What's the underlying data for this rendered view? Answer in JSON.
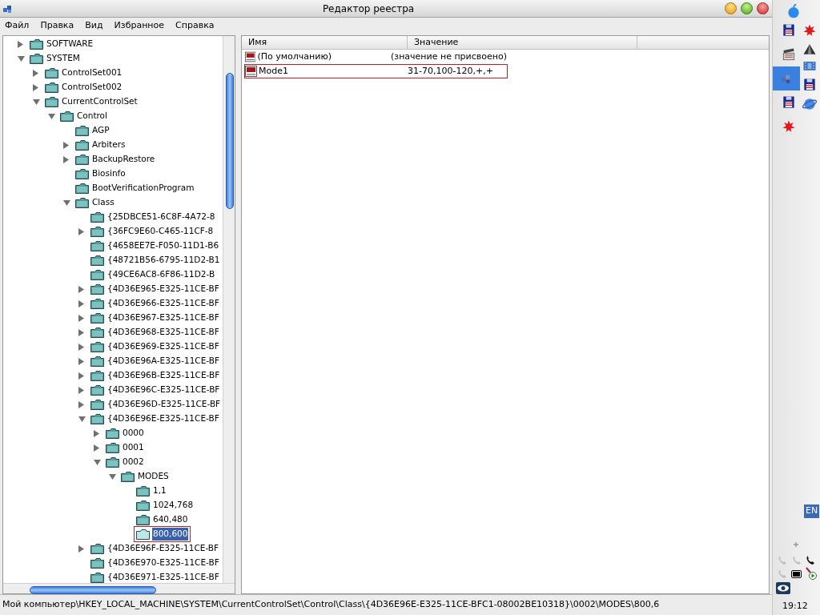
{
  "window": {
    "title": "Редактор реестра"
  },
  "menu": [
    "Файл",
    "Правка",
    "Вид",
    "Избранное",
    "Справка"
  ],
  "tree": [
    {
      "label": "SOFTWARE",
      "expanded": false,
      "selected": false,
      "marked": false
    },
    {
      "label": "SYSTEM",
      "expanded": true,
      "selected": false,
      "marked": false,
      "children": [
        {
          "label": "ControlSet001",
          "expanded": false,
          "selected": false,
          "marked": false
        },
        {
          "label": "ControlSet002",
          "expanded": false,
          "selected": false,
          "marked": false
        },
        {
          "label": "CurrentControlSet",
          "expanded": true,
          "selected": false,
          "marked": false,
          "children": [
            {
              "label": "Control",
              "expanded": true,
              "selected": false,
              "marked": false,
              "children": [
                {
                  "label": "AGP",
                  "selected": false,
                  "marked": false
                },
                {
                  "label": "Arbiters",
                  "expanded": false,
                  "selected": false,
                  "marked": false
                },
                {
                  "label": "BackupRestore",
                  "expanded": false,
                  "selected": false,
                  "marked": false
                },
                {
                  "label": "Biosinfo",
                  "selected": false,
                  "marked": false
                },
                {
                  "label": "BootVerificationProgram",
                  "selected": false,
                  "marked": false
                },
                {
                  "label": "Class",
                  "expanded": true,
                  "selected": false,
                  "marked": false,
                  "children": [
                    {
                      "label": "{25DBCE51-6C8F-4A72-8",
                      "selected": false,
                      "marked": false
                    },
                    {
                      "label": "{36FC9E60-C465-11CF-8",
                      "expanded": false,
                      "selected": false,
                      "marked": false
                    },
                    {
                      "label": "{4658EE7E-F050-11D1-B6",
                      "selected": false,
                      "marked": false
                    },
                    {
                      "label": "{48721B56-6795-11D2-B1",
                      "selected": false,
                      "marked": false
                    },
                    {
                      "label": "{49CE6AC8-6F86-11D2-B",
                      "selected": false,
                      "marked": false
                    },
                    {
                      "label": "{4D36E965-E325-11CE-BF",
                      "expanded": false,
                      "selected": false,
                      "marked": false
                    },
                    {
                      "label": "{4D36E966-E325-11CE-BF",
                      "expanded": false,
                      "selected": false,
                      "marked": false
                    },
                    {
                      "label": "{4D36E967-E325-11CE-BF",
                      "expanded": false,
                      "selected": false,
                      "marked": false
                    },
                    {
                      "label": "{4D36E968-E325-11CE-BF",
                      "expanded": false,
                      "selected": false,
                      "marked": false
                    },
                    {
                      "label": "{4D36E969-E325-11CE-BF",
                      "expanded": false,
                      "selected": false,
                      "marked": false
                    },
                    {
                      "label": "{4D36E96A-E325-11CE-BF",
                      "expanded": false,
                      "selected": false,
                      "marked": false
                    },
                    {
                      "label": "{4D36E96B-E325-11CE-BF",
                      "expanded": false,
                      "selected": false,
                      "marked": false
                    },
                    {
                      "label": "{4D36E96C-E325-11CE-BF",
                      "expanded": false,
                      "selected": false,
                      "marked": false
                    },
                    {
                      "label": "{4D36E96D-E325-11CE-BF",
                      "expanded": false,
                      "selected": false,
                      "marked": false
                    },
                    {
                      "label": "{4D36E96E-E325-11CE-BF",
                      "expanded": true,
                      "selected": false,
                      "marked": false,
                      "children": [
                        {
                          "label": "0000",
                          "expanded": false,
                          "selected": false,
                          "marked": false
                        },
                        {
                          "label": "0001",
                          "expanded": false,
                          "selected": false,
                          "marked": false
                        },
                        {
                          "label": "0002",
                          "expanded": true,
                          "selected": false,
                          "marked": false,
                          "children": [
                            {
                              "label": "MODES",
                              "expanded": true,
                              "selected": false,
                              "marked": false,
                              "children": [
                                {
                                  "label": "1,1",
                                  "selected": false,
                                  "marked": false
                                },
                                {
                                  "label": "1024,768",
                                  "selected": false,
                                  "marked": false
                                },
                                {
                                  "label": "640,480",
                                  "selected": false,
                                  "marked": false
                                },
                                {
                                  "label": "800,600",
                                  "selected": true,
                                  "marked": true
                                }
                              ]
                            }
                          ]
                        }
                      ]
                    },
                    {
                      "label": "{4D36E96F-E325-11CE-BF",
                      "expanded": false,
                      "selected": false,
                      "marked": false
                    },
                    {
                      "label": "{4D36E970-E325-11CE-BF",
                      "selected": false,
                      "marked": false
                    },
                    {
                      "label": "{4D36E971-E325-11CE-BF",
                      "selected": false,
                      "marked": false
                    }
                  ]
                }
              ]
            }
          ]
        }
      ]
    }
  ],
  "values": {
    "columns": [
      "Имя",
      "Значение"
    ],
    "rows": [
      {
        "name": "(По умолчанию)",
        "value": "(значение не присвоено)",
        "marked": false
      },
      {
        "name": "Mode1",
        "value": "31-70,100-120,+,+",
        "marked": true
      }
    ]
  },
  "status_bar": "Мой компьютер\\HKEY_LOCAL_MACHINE\\SYSTEM\\CurrentControlSet\\Control\\Class\\{4D36E96E-E325-11CE-BFC1-08002BE10318}\\0002\\MODES\\800,6",
  "dock": {
    "items": [
      {
        "kind": "apple",
        "selected": false
      },
      {
        "kind": "floppy",
        "selected": false
      },
      {
        "kind": "splat",
        "selected": false
      },
      {
        "kind": "clapper",
        "selected": false
      },
      {
        "kind": "pyramid",
        "selected": false
      },
      {
        "kind": "cubes",
        "selected": true
      },
      {
        "kind": "film",
        "selected": false
      },
      {
        "kind": "floppy",
        "selected": false
      },
      {
        "kind": "floppy",
        "selected": false
      },
      {
        "kind": "globe",
        "selected": false
      },
      {
        "kind": "splat",
        "selected": false
      }
    ],
    "language": "EN",
    "clock": "19:12"
  }
}
